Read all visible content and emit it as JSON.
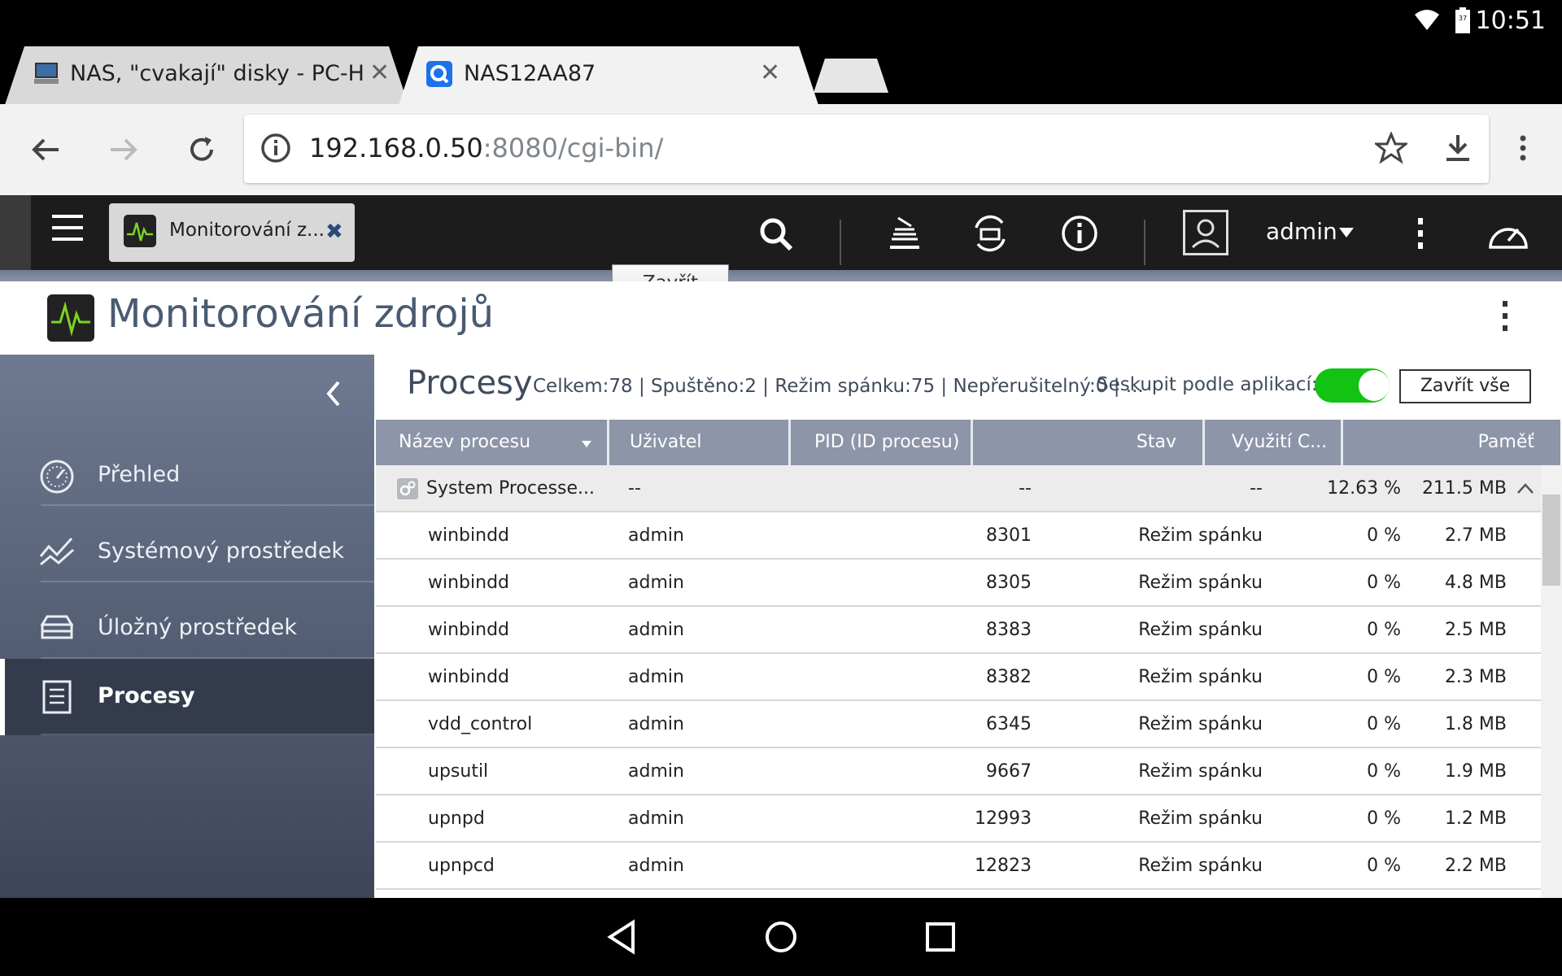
{
  "status_bar": {
    "time": "10:51",
    "battery_level": "37"
  },
  "browser": {
    "tabs": [
      {
        "title": "NAS, \"cvakají\" disky - PC-HELP",
        "active": false
      },
      {
        "title": "NAS12AA87",
        "active": true
      }
    ],
    "url_host": "192.168.0.50",
    "url_rest": ":8080/cgi-bin/"
  },
  "nas_header": {
    "app_tab_label": "Monitorování z...",
    "user_label": "admin",
    "close_popup_label": "Zavřít"
  },
  "app": {
    "title": "Monitorování zdrojů",
    "sidebar": {
      "items": [
        {
          "label": "Přehled",
          "icon": "gauge-icon",
          "active": false
        },
        {
          "label": "Systémový prostředek",
          "icon": "line-chart-icon",
          "active": false
        },
        {
          "label": "Úložný prostředek",
          "icon": "storage-icon",
          "active": false
        },
        {
          "label": "Procesy",
          "icon": "list-document-icon",
          "active": true
        }
      ]
    },
    "processes": {
      "title": "Procesy",
      "stats": "Celkem:78 | Spuštěno:2 | Režim spánku:75 | Nepřerušitelný:0 | ...",
      "group_label": "Seskupit podle aplikací:",
      "group_enabled": true,
      "close_all_label": "Zavřít vše",
      "columns": [
        "Název procesu",
        "Uživatel",
        "PID (ID procesu)",
        "Stav",
        "Využití C...",
        "Paměť"
      ],
      "group_row": {
        "name": "System Processe...",
        "user": "--",
        "pid": "--",
        "state": "--",
        "cpu": "12.63 %",
        "memory": "211.5 MB"
      },
      "rows": [
        {
          "name": "winbindd",
          "user": "admin",
          "pid": "8301",
          "state": "Režim spánku",
          "cpu": "0 %",
          "memory": "2.7 MB"
        },
        {
          "name": "winbindd",
          "user": "admin",
          "pid": "8305",
          "state": "Režim spánku",
          "cpu": "0 %",
          "memory": "4.8 MB"
        },
        {
          "name": "winbindd",
          "user": "admin",
          "pid": "8383",
          "state": "Režim spánku",
          "cpu": "0 %",
          "memory": "2.5 MB"
        },
        {
          "name": "winbindd",
          "user": "admin",
          "pid": "8382",
          "state": "Režim spánku",
          "cpu": "0 %",
          "memory": "2.3 MB"
        },
        {
          "name": "vdd_control",
          "user": "admin",
          "pid": "6345",
          "state": "Režim spánku",
          "cpu": "0 %",
          "memory": "1.8 MB"
        },
        {
          "name": "upsutil",
          "user": "admin",
          "pid": "9667",
          "state": "Režim spánku",
          "cpu": "0 %",
          "memory": "1.9 MB"
        },
        {
          "name": "upnpd",
          "user": "admin",
          "pid": "12993",
          "state": "Režim spánku",
          "cpu": "0 %",
          "memory": "1.2 MB"
        },
        {
          "name": "upnpcd",
          "user": "admin",
          "pid": "12823",
          "state": "Režim spánku",
          "cpu": "0 %",
          "memory": "2.2 MB"
        }
      ]
    }
  },
  "colors": {
    "toggle_on": "#13c313",
    "sidebar_top": "#6e7a91",
    "table_header": "#8d95a9"
  }
}
